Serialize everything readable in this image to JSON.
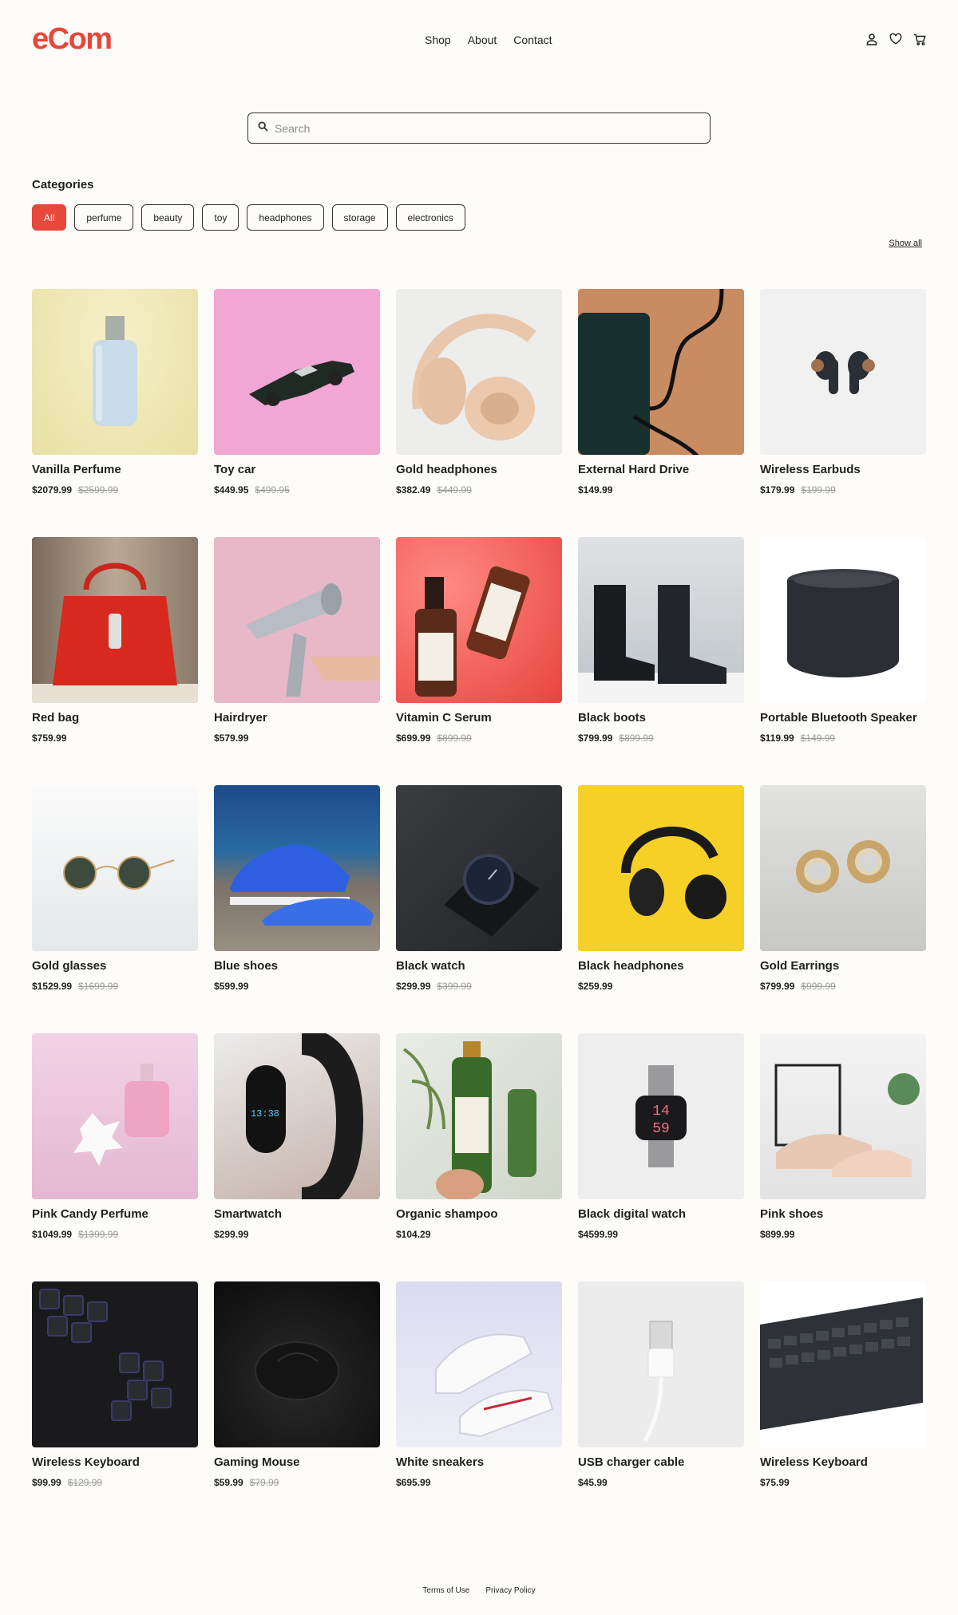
{
  "brand": {
    "name": "eCom",
    "color": "#e8473b"
  },
  "nav": {
    "links": [
      "Shop",
      "About",
      "Contact"
    ]
  },
  "header_icons": [
    "user-icon",
    "heart-icon",
    "cart-icon"
  ],
  "search": {
    "placeholder": "Search",
    "value": ""
  },
  "categories": {
    "title": "Categories",
    "items": [
      "All",
      "perfume",
      "beauty",
      "toy",
      "headphones",
      "storage",
      "electronics"
    ],
    "active": "All",
    "show_all": "Show all"
  },
  "products": [
    {
      "name": "Vanilla Perfume",
      "price": "$2079.99",
      "old_price": "$2599.99"
    },
    {
      "name": "Toy car",
      "price": "$449.95",
      "old_price": "$499.95"
    },
    {
      "name": "Gold headphones",
      "price": "$382.49",
      "old_price": "$449.99"
    },
    {
      "name": "External Hard Drive",
      "price": "$149.99",
      "old_price": ""
    },
    {
      "name": "Wireless Earbuds",
      "price": "$179.99",
      "old_price": "$199.99"
    },
    {
      "name": "Red bag",
      "price": "$759.99",
      "old_price": ""
    },
    {
      "name": "Hairdryer",
      "price": "$579.99",
      "old_price": ""
    },
    {
      "name": "Vitamin C Serum",
      "price": "$699.99",
      "old_price": "$899.99"
    },
    {
      "name": "Black boots",
      "price": "$799.99",
      "old_price": "$899.99"
    },
    {
      "name": "Portable Bluetooth Speaker",
      "price": "$119.99",
      "old_price": "$149.99"
    },
    {
      "name": "Gold glasses",
      "price": "$1529.99",
      "old_price": "$1699.99"
    },
    {
      "name": "Blue shoes",
      "price": "$599.99",
      "old_price": ""
    },
    {
      "name": "Black watch",
      "price": "$299.99",
      "old_price": "$399.99"
    },
    {
      "name": "Black headphones",
      "price": "$259.99",
      "old_price": ""
    },
    {
      "name": "Gold Earrings",
      "price": "$799.99",
      "old_price": "$999.99"
    },
    {
      "name": "Pink Candy Perfume",
      "price": "$1049.99",
      "old_price": "$1399.99"
    },
    {
      "name": "Smartwatch",
      "price": "$299.99",
      "old_price": ""
    },
    {
      "name": "Organic shampoo",
      "price": "$104.29",
      "old_price": ""
    },
    {
      "name": "Black digital watch",
      "price": "$4599.99",
      "old_price": ""
    },
    {
      "name": "Pink shoes",
      "price": "$899.99",
      "old_price": ""
    },
    {
      "name": "Wireless Keyboard",
      "price": "$99.99",
      "old_price": "$129.99"
    },
    {
      "name": "Gaming Mouse",
      "price": "$59.99",
      "old_price": "$79.99"
    },
    {
      "name": "White sneakers",
      "price": "$695.99",
      "old_price": ""
    },
    {
      "name": "USB charger cable",
      "price": "$45.99",
      "old_price": ""
    },
    {
      "name": "Wireless Keyboard",
      "price": "$75.99",
      "old_price": ""
    }
  ],
  "footer": {
    "links": [
      "Terms of Use",
      "Privacy Policy"
    ]
  }
}
